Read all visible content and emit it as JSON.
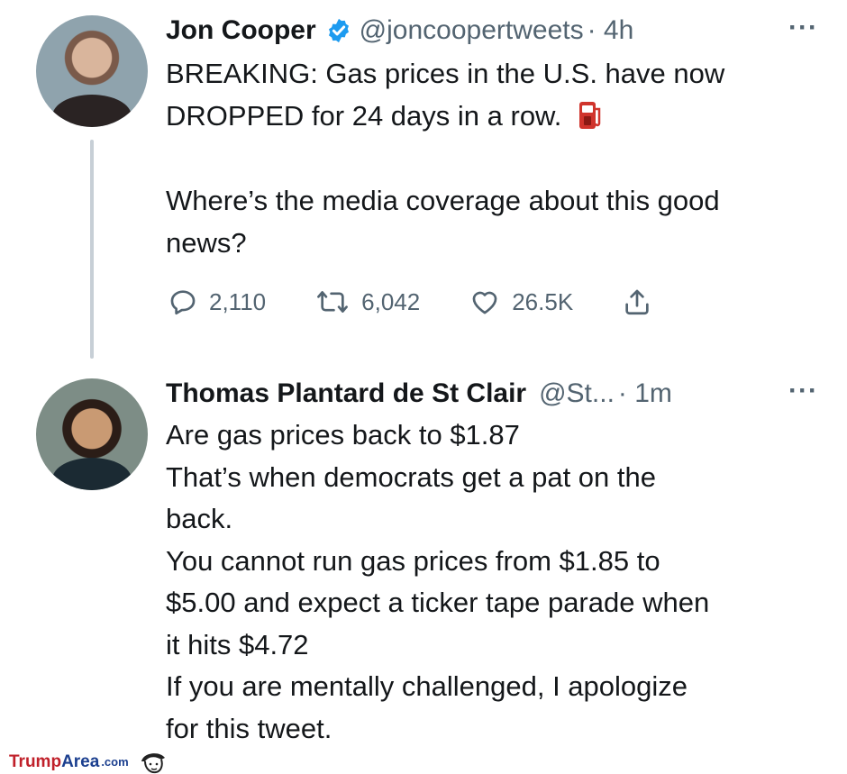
{
  "tweets": [
    {
      "name": "Jon Cooper",
      "handle": "@joncoopertweets",
      "time": "· 4h",
      "more": "···",
      "lines": [
        "BREAKING: Gas prices in the U.S. have now",
        "DROPPED for 24 days in a row."
      ],
      "lines2": [
        "Where’s the media coverage about this good",
        "news?"
      ],
      "actions": {
        "replies": "2,110",
        "retweets": "6,042",
        "likes": "26.5K"
      }
    },
    {
      "name": "Thomas Plantard de St Clair",
      "handle": "@St...",
      "time": "· 1m",
      "more": "···",
      "lines": [
        "Are gas prices back to $1.87",
        "That’s when democrats get a pat on the",
        "back.",
        "You cannot run gas prices from $1.85 to",
        "$5.00 and expect a ticker tape parade when",
        "it hits $4.72",
        "If you are mentally challenged, I apologize",
        "for this tweet."
      ]
    }
  ],
  "watermark": {
    "part1": "Trump",
    "part2": "Area",
    "part3": ".com"
  },
  "colors": {
    "verified": "#1d9bf0",
    "text": "#14171a",
    "muted": "#536471",
    "fuel_icon": "#d0342c"
  },
  "icons": [
    "verified-badge-icon",
    "fuel-pump-icon",
    "reply-icon",
    "retweet-icon",
    "like-icon",
    "share-icon",
    "more-icon"
  ]
}
